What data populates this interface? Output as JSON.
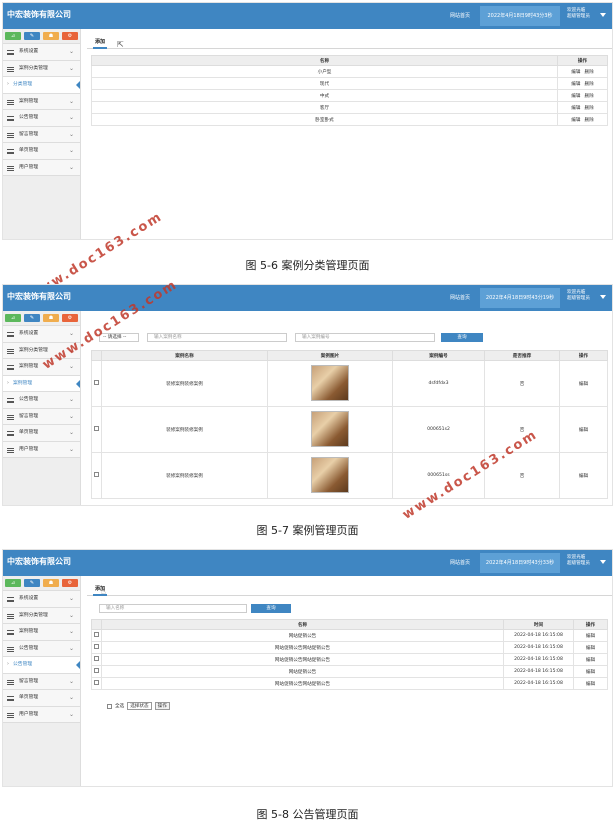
{
  "app": {
    "brand": "中宏装饰有限公司",
    "home_link": "网站首页",
    "clock_1": "2022年4月18日9时43分3秒",
    "clock_2": "2022年4月18日9时43分19秒",
    "clock_3": "2022年4月18日9时43分33秒",
    "user_line1": "欢迎光临",
    "user_line2": "超级管理员"
  },
  "sidebar_1": [
    "系统设置",
    "案例分类管理",
    "分类管理",
    "案例管理",
    "公告管理",
    "留言管理",
    "单页管理",
    "用户管理"
  ],
  "sidebar_2": [
    "系统设置",
    "案例分类管理",
    "案例管理",
    "案例管理",
    "公告管理",
    "留言管理",
    "单页管理",
    "用户管理"
  ],
  "sidebar_3": [
    "系统设置",
    "案例分类管理",
    "案例管理",
    "公告管理",
    "公告管理",
    "留言管理",
    "单页管理",
    "用户管理"
  ],
  "panel1": {
    "tab": "添加",
    "headers": [
      "名称",
      "操作"
    ],
    "rows": [
      "小户型",
      "现代",
      "中式",
      "客厅",
      "卧室卧式"
    ],
    "edit": "编辑",
    "del": "删除"
  },
  "panel2": {
    "select": "-- 请选择 --",
    "ph_name": "输入案例名称",
    "ph_code": "输入案例编号",
    "search": "查询",
    "headers": [
      "案例名称",
      "案例图片",
      "案例编号",
      "是否推荐",
      "操作"
    ],
    "rows": [
      {
        "name": "装修案例装修案例",
        "code": "dsfdfdx3",
        "rec": "否"
      },
      {
        "name": "装修案例装修案例",
        "code": "000651s2",
        "rec": "否"
      },
      {
        "name": "装修案例装修案例",
        "code": "000651ss",
        "rec": "否"
      }
    ],
    "edit": "编辑"
  },
  "panel3": {
    "tab": "添加",
    "ph_name": "输入名称",
    "search": "查询",
    "headers": [
      "名称",
      "时间",
      "操作"
    ],
    "rows": [
      {
        "title": "网站促销公告",
        "time": "2022-04-18 16:15:08"
      },
      {
        "title": "网站促销公告网站促销公告",
        "time": "2022-04-18 16:15:08"
      },
      {
        "title": "网站促销公告网站促销公告",
        "time": "2022-04-18 16:15:08"
      },
      {
        "title": "网站促销公告",
        "time": "2022-04-18 16:15:08"
      },
      {
        "title": "网站促销公告网站促销公告",
        "time": "2022-04-18 16:15:08"
      }
    ],
    "edit": "编辑",
    "select_all": "全选",
    "bulk": "选择状态",
    "do": "操作"
  },
  "captions": {
    "c1": "图 5-6 案例分类管理页面",
    "c2": "图 5-7 案例管理页面",
    "c3": "图 5-8 公告管理页面"
  },
  "watermark": "www.doc163.com"
}
